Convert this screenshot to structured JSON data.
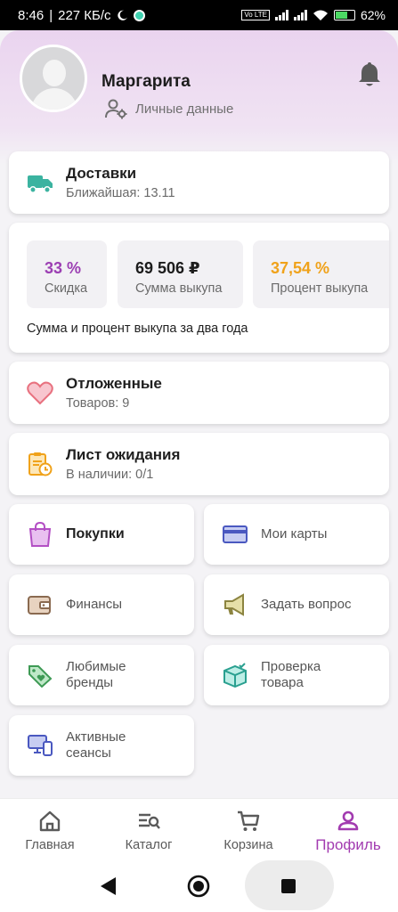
{
  "status_bar": {
    "time": "8:46",
    "speed": "227 КБ/с",
    "volte": "Vo LTE",
    "battery": "62%"
  },
  "profile": {
    "name": "Маргарита",
    "personal_data_label": "Личные данные"
  },
  "delivery": {
    "title": "Доставки",
    "subtitle": "Ближайшая: 13.11"
  },
  "stats": {
    "items": [
      {
        "value": "33 %",
        "label": "Скидка",
        "color": "#9c3fb3"
      },
      {
        "value": "69 506 ₽",
        "label": "Сумма выкупа",
        "color": "#1c1c1c"
      },
      {
        "value": "37,54 %",
        "label": "Процент выкупа",
        "color": "#f0a21a"
      }
    ],
    "note": "Сумма и процент выкупа за два года"
  },
  "favorites": {
    "title": "Отложенные",
    "subtitle": "Товаров: 9"
  },
  "waitlist": {
    "title": "Лист ожидания",
    "subtitle": "В наличии: 0/1"
  },
  "tiles": {
    "purchases": "Покупки",
    "my_cards": "Мои карты",
    "finance": "Финансы",
    "ask_question": "Задать вопрос",
    "fav_brands": [
      "Любимые",
      "бренды"
    ],
    "check_product": [
      "Проверка",
      "товара"
    ],
    "active_sessions": [
      "Активные",
      "сеансы"
    ]
  },
  "bottom_nav": {
    "items": [
      {
        "label": "Главная",
        "icon": "home-icon"
      },
      {
        "label": "Каталог",
        "icon": "catalog-search-icon"
      },
      {
        "label": "Корзина",
        "icon": "cart-icon"
      },
      {
        "label": "Профиль",
        "icon": "profile-icon"
      }
    ],
    "active_color": "#a23bb0"
  },
  "colors": {
    "accent": "#a23bb0",
    "header_tint": "#ead4ef"
  }
}
